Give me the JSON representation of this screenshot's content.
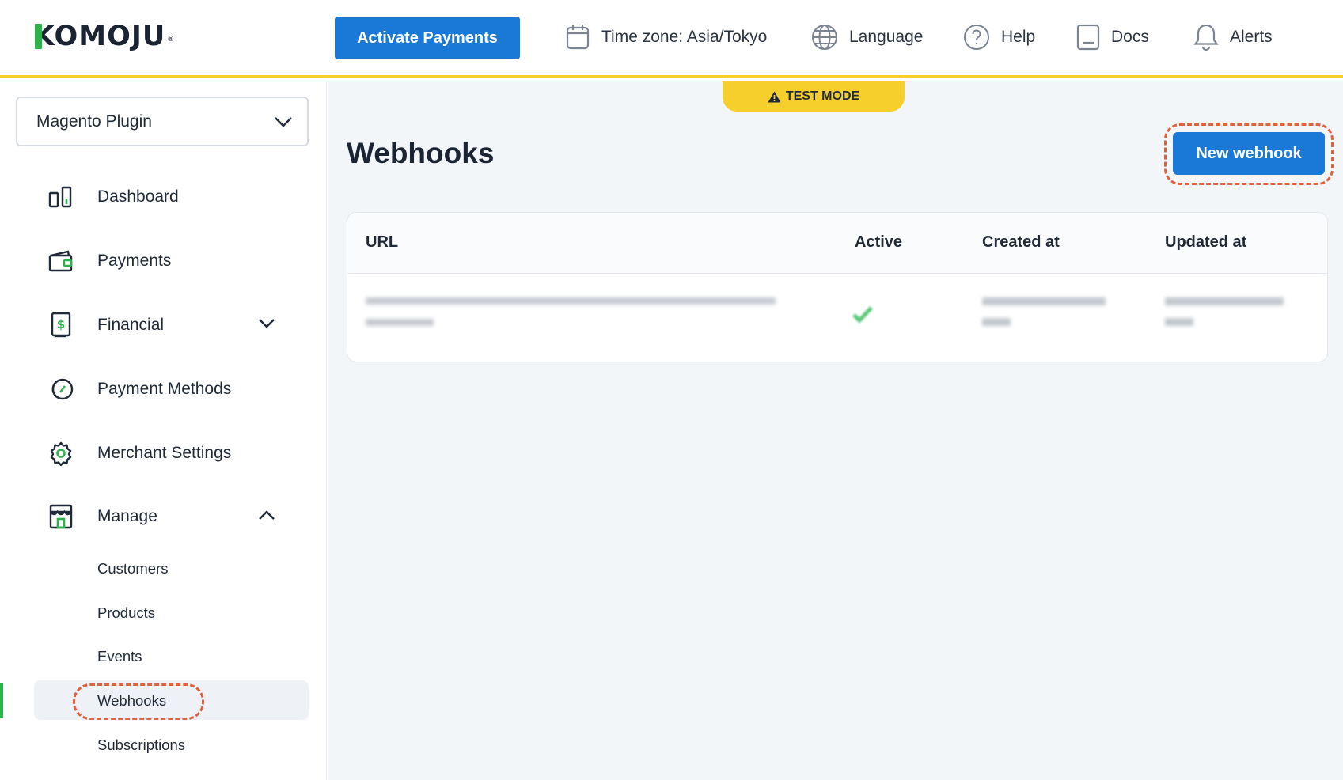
{
  "header": {
    "logo_text": "KOMOJU",
    "activate_label": "Activate Payments",
    "timezone_label": "Time zone: Asia/Tokyo",
    "language_label": "Language",
    "help_label": "Help",
    "docs_label": "Docs",
    "alerts_label": "Alerts"
  },
  "sidebar": {
    "account": "Magento Plugin",
    "items": [
      {
        "label": "Dashboard",
        "icon": "dashboard-icon"
      },
      {
        "label": "Payments",
        "icon": "wallet-icon"
      },
      {
        "label": "Financial",
        "icon": "financial-icon"
      },
      {
        "label": "Payment Methods",
        "icon": "payment-methods-icon"
      },
      {
        "label": "Merchant Settings",
        "icon": "gear-icon"
      },
      {
        "label": "Manage",
        "icon": "store-icon"
      }
    ],
    "manage_sub": [
      "Customers",
      "Products",
      "Events",
      "Webhooks",
      "Subscriptions"
    ]
  },
  "main": {
    "test_mode": "TEST MODE",
    "title": "Webhooks",
    "new_webhook_label": "New webhook",
    "table": {
      "columns": [
        "URL",
        "Active",
        "Created at",
        "Updated at"
      ]
    }
  },
  "colors": {
    "primary": "#1a78d6",
    "accent_yellow": "#f6cf2d",
    "brand_green": "#2cb34a",
    "highlight": "#e0623c"
  }
}
